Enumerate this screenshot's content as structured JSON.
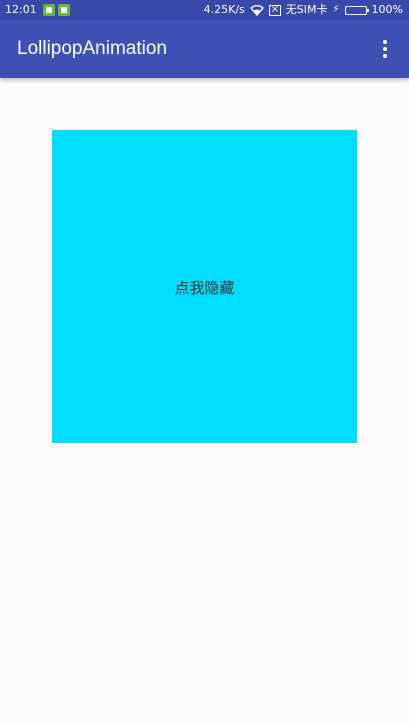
{
  "status_bar": {
    "time": "12:01",
    "network_speed": "4.25K/s",
    "sim_status": "无SIM卡",
    "battery_percent": "100%",
    "battery_level": 1.0
  },
  "app_bar": {
    "title": "LollipopAnimation",
    "menu_icon": "more-vert-icon"
  },
  "main": {
    "box_label": "点我隐藏",
    "box_color": "#00ddff"
  },
  "colors": {
    "primary": "#3f51b5",
    "primary_dark": "#3949ab",
    "background": "#fafafa"
  }
}
